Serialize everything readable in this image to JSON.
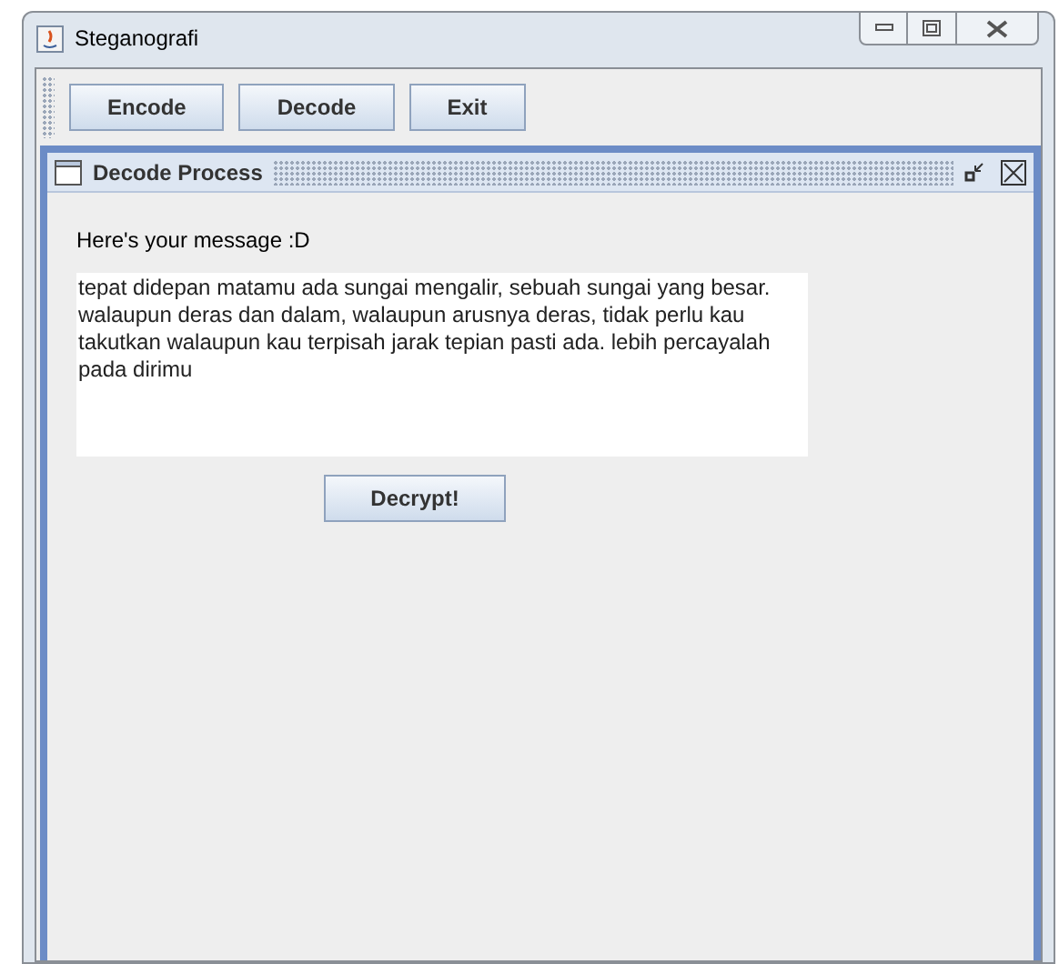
{
  "window": {
    "title": "Steganografi"
  },
  "toolbar": {
    "buttons": [
      {
        "label": "Encode"
      },
      {
        "label": "Decode"
      },
      {
        "label": "Exit"
      }
    ]
  },
  "internal_frame": {
    "title": "Decode Process",
    "label": "Here's your message :D",
    "message": "tepat didepan matamu ada sungai mengalir, sebuah sungai yang besar. walaupun deras dan dalam, walaupun arusnya deras, tidak perlu kau takutkan walaupun kau terpisah jarak tepian pasti ada. lebih percayalah pada dirimu",
    "button": "Decrypt!"
  }
}
